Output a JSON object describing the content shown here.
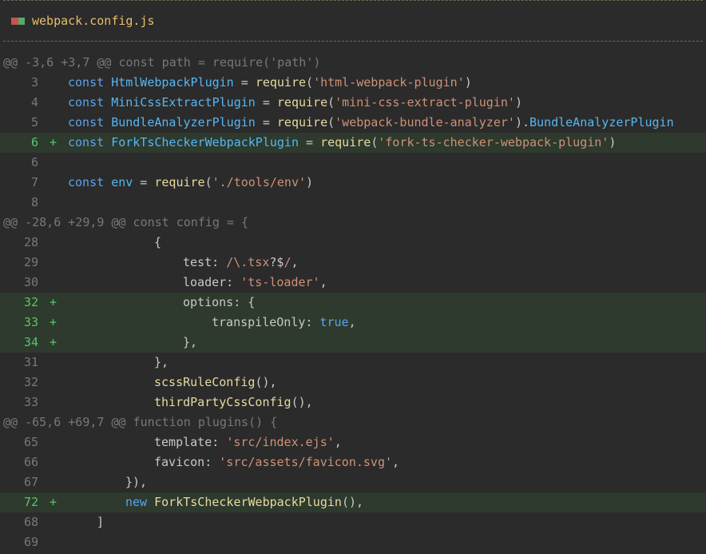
{
  "file": {
    "name": "webpack.config.js"
  },
  "colors": {
    "background": "#2b2b2b",
    "added_background": "#2d3a2d",
    "keyword": "#5aa4f0",
    "string": "#ce9178",
    "function": "#e8d9a0",
    "added_marker": "#59c66b"
  },
  "rows": [
    {
      "kind": "hunk",
      "text": "@@ -3,6 +3,7 @@ const path = require('path')"
    },
    {
      "kind": "ctx",
      "ln": "3",
      "indent": 0,
      "tokens": [
        [
          "kw",
          "const "
        ],
        [
          "id",
          "HtmlWebpackPlugin"
        ],
        [
          "pl",
          " = "
        ],
        [
          "fn",
          "require"
        ],
        [
          "pl",
          "("
        ],
        [
          "str",
          "'html-webpack-plugin'"
        ],
        [
          "pl",
          ")"
        ]
      ]
    },
    {
      "kind": "ctx",
      "ln": "4",
      "indent": 0,
      "tokens": [
        [
          "kw",
          "const "
        ],
        [
          "id",
          "MiniCssExtractPlugin"
        ],
        [
          "pl",
          " = "
        ],
        [
          "fn",
          "require"
        ],
        [
          "pl",
          "("
        ],
        [
          "str",
          "'mini-css-extract-plugin'"
        ],
        [
          "pl",
          ")"
        ]
      ]
    },
    {
      "kind": "ctx",
      "ln": "5",
      "indent": 0,
      "tokens": [
        [
          "kw",
          "const "
        ],
        [
          "id",
          "BundleAnalyzerPlugin"
        ],
        [
          "pl",
          " = "
        ],
        [
          "fn",
          "require"
        ],
        [
          "pl",
          "("
        ],
        [
          "str",
          "'webpack-bundle-analyzer'"
        ],
        [
          "pl",
          ")."
        ],
        [
          "id",
          "BundleAnalyzerPlugin"
        ]
      ]
    },
    {
      "kind": "add",
      "ln": "6",
      "indent": 0,
      "tokens": [
        [
          "kw",
          "const "
        ],
        [
          "id",
          "ForkTsCheckerWebpackPlugin"
        ],
        [
          "pl",
          " = "
        ],
        [
          "fn",
          "require"
        ],
        [
          "pl",
          "("
        ],
        [
          "str",
          "'fork-ts-checker-webpack-plugin'"
        ],
        [
          "pl",
          ")"
        ]
      ]
    },
    {
      "kind": "ctx",
      "ln": "6",
      "indent": 0,
      "tokens": []
    },
    {
      "kind": "ctx",
      "ln": "7",
      "indent": 0,
      "tokens": [
        [
          "kw",
          "const "
        ],
        [
          "id",
          "env"
        ],
        [
          "pl",
          " = "
        ],
        [
          "fn",
          "require"
        ],
        [
          "pl",
          "("
        ],
        [
          "str",
          "'./tools/env'"
        ],
        [
          "pl",
          ")"
        ]
      ]
    },
    {
      "kind": "ctx",
      "ln": "8",
      "indent": 0,
      "tokens": []
    },
    {
      "kind": "hunk",
      "text": "@@ -28,6 +29,9 @@ const config = {"
    },
    {
      "kind": "ctx",
      "ln": "28",
      "indent": 3,
      "tokens": [
        [
          "pl",
          "{"
        ]
      ]
    },
    {
      "kind": "ctx",
      "ln": "29",
      "indent": 4,
      "tokens": [
        [
          "pl",
          "test: "
        ],
        [
          "re",
          "/\\.tsx"
        ],
        [
          "pl",
          "?$"
        ],
        [
          "re",
          "/"
        ],
        [
          "pl",
          ","
        ]
      ]
    },
    {
      "kind": "ctx",
      "ln": "30",
      "indent": 4,
      "tokens": [
        [
          "pl",
          "loader: "
        ],
        [
          "str",
          "'ts-loader'"
        ],
        [
          "pl",
          ","
        ]
      ]
    },
    {
      "kind": "add",
      "ln": "32",
      "indent": 4,
      "tokens": [
        [
          "pl",
          "options: {"
        ]
      ]
    },
    {
      "kind": "add",
      "ln": "33",
      "indent": 5,
      "tokens": [
        [
          "pl",
          "transpileOnly: "
        ],
        [
          "bool",
          "true"
        ],
        [
          "pl",
          ","
        ]
      ]
    },
    {
      "kind": "add",
      "ln": "34",
      "indent": 4,
      "tokens": [
        [
          "pl",
          "},"
        ]
      ]
    },
    {
      "kind": "ctx",
      "ln": "31",
      "indent": 3,
      "tokens": [
        [
          "pl",
          "},"
        ]
      ]
    },
    {
      "kind": "ctx",
      "ln": "32",
      "indent": 3,
      "tokens": [
        [
          "fn",
          "scssRuleConfig"
        ],
        [
          "pl",
          "(),"
        ]
      ]
    },
    {
      "kind": "ctx",
      "ln": "33",
      "indent": 3,
      "tokens": [
        [
          "fn",
          "thirdPartyCssConfig"
        ],
        [
          "pl",
          "(),"
        ]
      ]
    },
    {
      "kind": "hunk",
      "text": "@@ -65,6 +69,7 @@ function plugins() {"
    },
    {
      "kind": "ctx",
      "ln": "65",
      "indent": 3,
      "tokens": [
        [
          "pl",
          "template: "
        ],
        [
          "str",
          "'src/index.ejs'"
        ],
        [
          "pl",
          ","
        ]
      ]
    },
    {
      "kind": "ctx",
      "ln": "66",
      "indent": 3,
      "tokens": [
        [
          "pl",
          "favicon: "
        ],
        [
          "str",
          "'src/assets/favicon.svg'"
        ],
        [
          "pl",
          ","
        ]
      ]
    },
    {
      "kind": "ctx",
      "ln": "67",
      "indent": 2,
      "tokens": [
        [
          "pl",
          "}),"
        ]
      ]
    },
    {
      "kind": "add",
      "ln": "72",
      "indent": 2,
      "tokens": [
        [
          "kw",
          "new "
        ],
        [
          "fn",
          "ForkTsCheckerWebpackPlugin"
        ],
        [
          "pl",
          "(),"
        ]
      ]
    },
    {
      "kind": "ctx",
      "ln": "68",
      "indent": 1,
      "tokens": [
        [
          "pl",
          "]"
        ]
      ]
    },
    {
      "kind": "ctx",
      "ln": "69",
      "indent": 0,
      "tokens": []
    }
  ],
  "added_marker": "+"
}
